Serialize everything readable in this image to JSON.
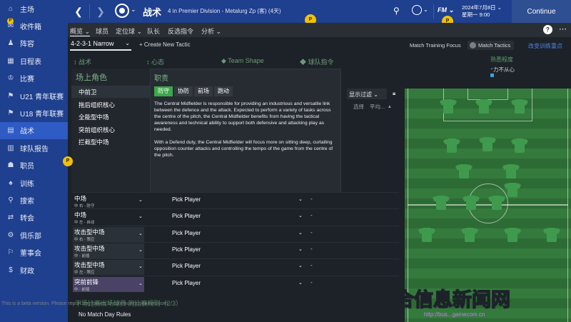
{
  "sidebar": {
    "items": [
      {
        "icon": "home-icon",
        "glyph": "⌂",
        "label": "主场"
      },
      {
        "icon": "inbox-icon",
        "glyph": "✉",
        "label": "收件箱"
      },
      {
        "icon": "squad-icon",
        "glyph": "♟",
        "label": "阵容"
      },
      {
        "icon": "calendar-icon",
        "glyph": "▦",
        "label": "日程表"
      },
      {
        "icon": "trophy-icon",
        "glyph": "♔",
        "label": "比赛"
      },
      {
        "icon": "u21-icon",
        "glyph": "⚑",
        "label": "U21 青年联赛"
      },
      {
        "icon": "u18-icon",
        "glyph": "⚑",
        "label": "U18 青年联赛"
      },
      {
        "icon": "tactics-icon",
        "glyph": "▤",
        "label": "战术"
      },
      {
        "icon": "report-icon",
        "glyph": "▥",
        "label": "球队报告"
      },
      {
        "icon": "staff-icon",
        "glyph": "☗",
        "label": "职员"
      },
      {
        "icon": "training-icon",
        "glyph": "♠",
        "label": "训练"
      },
      {
        "icon": "scouting-icon",
        "glyph": "⚲",
        "label": "搜索"
      },
      {
        "icon": "transfer-icon",
        "glyph": "⇄",
        "label": "转会"
      },
      {
        "icon": "club-icon",
        "glyph": "⚙",
        "label": "俱乐部"
      },
      {
        "icon": "board-icon",
        "glyph": "⚐",
        "label": "董事会"
      },
      {
        "icon": "finance-icon",
        "glyph": "$",
        "label": "财政"
      }
    ],
    "active_index": 7
  },
  "topbar": {
    "title": "战术",
    "subtitle": "4 in Premier Division - Metalurg Zp (客) (4天)",
    "date_line1": "2024年7月8日 ⌄",
    "date_line2": "星期一 9:00",
    "fm_label": "FM",
    "continue_label": "Continue",
    "badge_glyph": "P"
  },
  "subnav": {
    "items": [
      "概览 ⌄",
      "球员",
      "定位球 ⌄",
      "队长",
      "反选指令",
      "分析 ⌄"
    ],
    "help_label": "?",
    "more_label": "⋯"
  },
  "toolbar": {
    "formation": "4-2-3-1 Narrow",
    "create_tactic": "+ Create New Tactic",
    "match_training_focus": "Match Training Focus",
    "match_tactics": "Match Tactics",
    "overview_link": "改变训练重点"
  },
  "header_strip": {
    "items": [
      "↕ 战术",
      "↕ 心态",
      "◆ Team Shape",
      "◆ 球队指令"
    ],
    "familiarity_title": "熟悉程度",
    "familiarity_value": "⁺力不从心"
  },
  "role_panel": {
    "title": "场上角色",
    "roles": [
      "中前卫",
      "拖后组织核心",
      "全能型中场",
      "突前组织核心",
      "拦截型中场"
    ],
    "selected_index": 0
  },
  "description": {
    "title": "职责",
    "duties": [
      "防守",
      "协防",
      "前场",
      "跑动"
    ],
    "active_duty": 0,
    "paragraphs": [
      "The Central Midfielder is responsible for providing an industrious and versatile link between the defence and the attack. Expected to perform a variety of tasks across the centre of the pitch, the Central Midfielder benefits from having the tactical awareness and technical ability to support both defensive and attacking play as needed.",
      "With a Defend duty, the Central Midfielder will focus more on sitting deep, curtailing opposition counter attacks and controlling the tempo of the game from the centre of the pitch."
    ]
  },
  "filter": {
    "label": "显示过滤 ⌄",
    "col1": "选择",
    "col2": "平均..."
  },
  "player_rows": [
    {
      "pos": "中场",
      "sub": "中 右 - 防守",
      "player": "Pick Player",
      "dash": "-",
      "style": "plain"
    },
    {
      "pos": "中场",
      "sub": "中 左 - 自动",
      "player": "Pick Player",
      "dash": "-",
      "style": "plain"
    },
    {
      "pos": "攻击型中场",
      "sub": "中 右 - 策应",
      "player": "Pick Player",
      "dash": "-",
      "style": "alt"
    },
    {
      "pos": "攻击型中场",
      "sub": "中 - 前插",
      "player": "Pick Player",
      "dash": "-",
      "style": "alt"
    },
    {
      "pos": "攻击型中场",
      "sub": "中 左 - 策应",
      "player": "Pick Player",
      "dash": "-",
      "style": "alt"
    },
    {
      "pos": "突前前锋",
      "sub": "中 - 前插",
      "player": "Pick Player",
      "dash": "-",
      "style": "sel"
    }
  ],
  "bottom": {
    "dim_text": "下场比赛出场球员   的比赛规则（2/3）",
    "no_match_day_rules": "No Match Day Rules",
    "beta_text": "This is a beta version. Please report any issues to community.sigames.com"
  },
  "watermark": {
    "main": "兴业综合信息新闻网",
    "url": "http://bus...gamecom.cn"
  },
  "colors": {
    "sidebar_bg": "#1f3f8f",
    "active_item": "#2e5bc4",
    "duty_active": "#3aa84b",
    "pitch": "#2d6b34",
    "shirt": "#3f9a4d",
    "badge": "#f2c200"
  }
}
